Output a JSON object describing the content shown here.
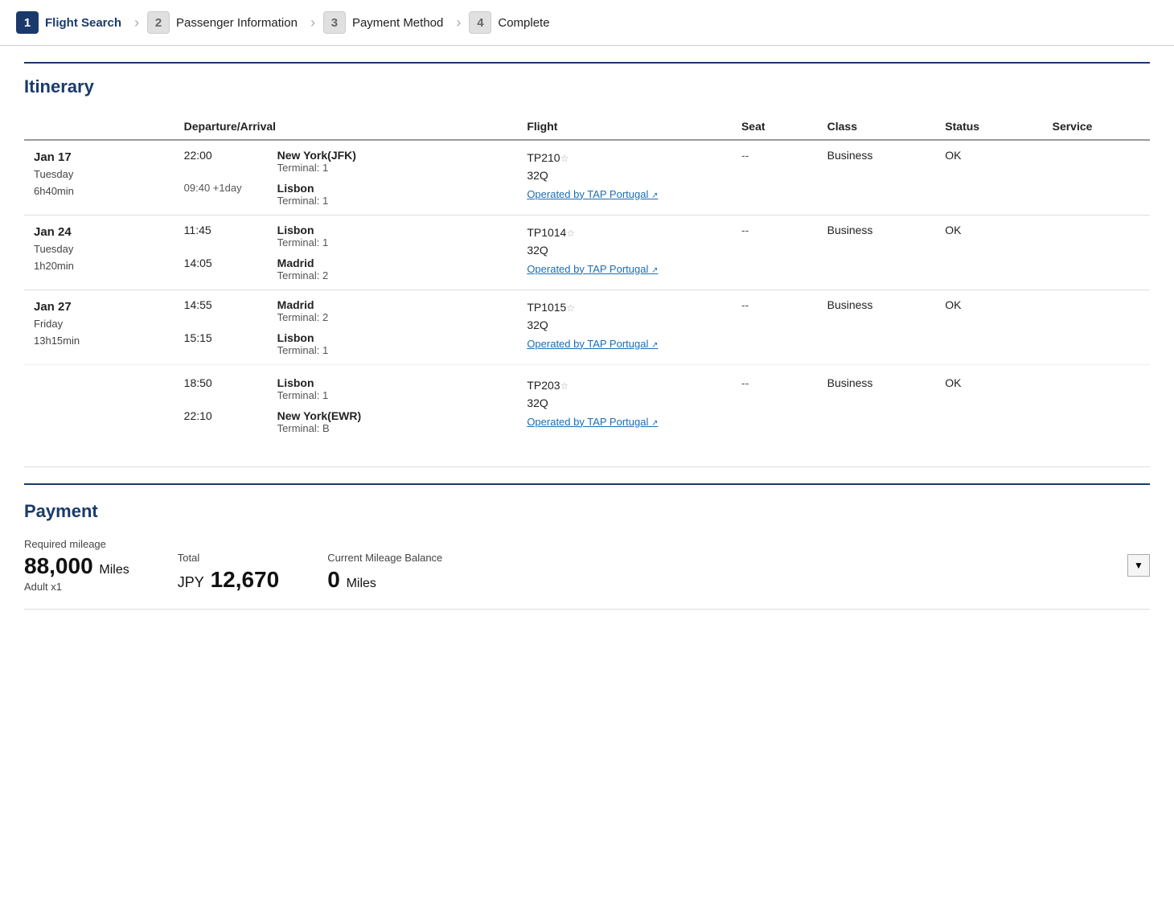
{
  "steps": [
    {
      "number": "1",
      "label": "Flight Search",
      "active": true
    },
    {
      "number": "2",
      "label": "Passenger Information",
      "active": false
    },
    {
      "number": "3",
      "label": "Payment Method",
      "active": false
    },
    {
      "number": "4",
      "label": "Complete",
      "active": false
    }
  ],
  "itinerary": {
    "title": "Itinerary",
    "columns": [
      "Departure/Arrival",
      "Flight",
      "Seat",
      "Class",
      "Status",
      "Service"
    ],
    "rows": [
      {
        "date": "Jan 17",
        "day": "Tuesday",
        "duration": "6h40min",
        "legs": [
          {
            "depTime": "22:00",
            "depAirport": "New York(JFK)",
            "depTerminal": "Terminal: 1",
            "arrTime": "09:40 +1day",
            "arrAirport": "Lisbon",
            "arrTerminal": "Terminal: 1",
            "flightNum": "TP210",
            "seat": "32Q",
            "operatedBy": "Operated by TAP Portugal",
            "seatAssign": "--",
            "class": "Business",
            "status": "OK",
            "service": ""
          }
        ]
      },
      {
        "date": "Jan 24",
        "day": "Tuesday",
        "duration": "1h20min",
        "legs": [
          {
            "depTime": "11:45",
            "depAirport": "Lisbon",
            "depTerminal": "Terminal: 1",
            "arrTime": "14:05",
            "arrAirport": "Madrid",
            "arrTerminal": "Terminal: 2",
            "flightNum": "TP1014",
            "seat": "32Q",
            "operatedBy": "Operated by TAP Portugal",
            "seatAssign": "--",
            "class": "Business",
            "status": "OK",
            "service": ""
          }
        ]
      },
      {
        "date": "Jan 27",
        "day": "Friday",
        "duration": "13h15min",
        "legs": [
          {
            "depTime": "14:55",
            "depAirport": "Madrid",
            "depTerminal": "Terminal: 2",
            "arrTime": "15:15",
            "arrAirport": "Lisbon",
            "arrTerminal": "Terminal: 1",
            "flightNum": "TP1015",
            "seat": "32Q",
            "operatedBy": "Operated by TAP Portugal",
            "seatAssign": "--",
            "class": "Business",
            "status": "OK",
            "service": ""
          },
          {
            "depTime": "18:50",
            "depAirport": "Lisbon",
            "depTerminal": "Terminal: 1",
            "arrTime": "22:10",
            "arrAirport": "New York(EWR)",
            "arrTerminal": "Terminal: B",
            "flightNum": "TP203",
            "seat": "32Q",
            "operatedBy": "Operated by TAP Portugal",
            "seatAssign": "--",
            "class": "Business",
            "status": "OK",
            "service": ""
          }
        ]
      }
    ]
  },
  "payment": {
    "title": "Payment",
    "required_mileage_label": "Required mileage",
    "required_mileage_value": "88,000",
    "required_mileage_unit": "Miles",
    "required_mileage_sub": "Adult x1",
    "total_label": "Total",
    "total_currency": "JPY",
    "total_value": "12,670",
    "balance_label": "Current Mileage Balance",
    "balance_value": "0",
    "balance_unit": "Miles",
    "dropdown_icon": "▼"
  }
}
